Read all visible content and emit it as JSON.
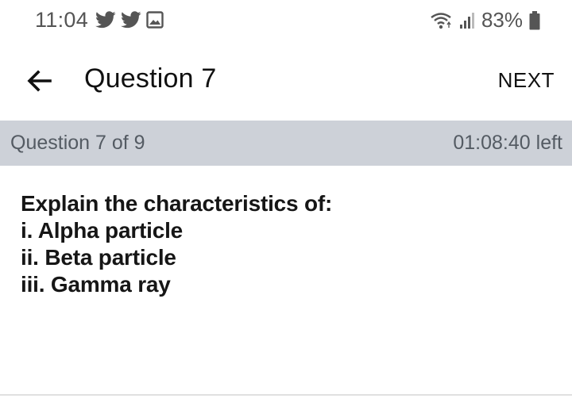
{
  "status_bar": {
    "time": "11:04",
    "battery": "83%",
    "icons_left": [
      "twitter-icon",
      "twitter-icon",
      "image-icon"
    ],
    "icons_right": [
      "wifi-icon",
      "signal-icon",
      "battery-icon"
    ]
  },
  "app_bar": {
    "title": "Question 7",
    "next_label": "NEXT",
    "back_icon": "arrow-left-icon"
  },
  "progress": {
    "label": "Question 7 of 9",
    "time_left": "01:08:40 left"
  },
  "question": {
    "lines": [
      "Explain the characteristics of:",
      "i. Alpha particle",
      "ii. Beta particle",
      "iii. Gamma ray"
    ]
  },
  "colors": {
    "band": "#cdd1d8",
    "band_text": "#545b63",
    "status_text": "#555555"
  }
}
